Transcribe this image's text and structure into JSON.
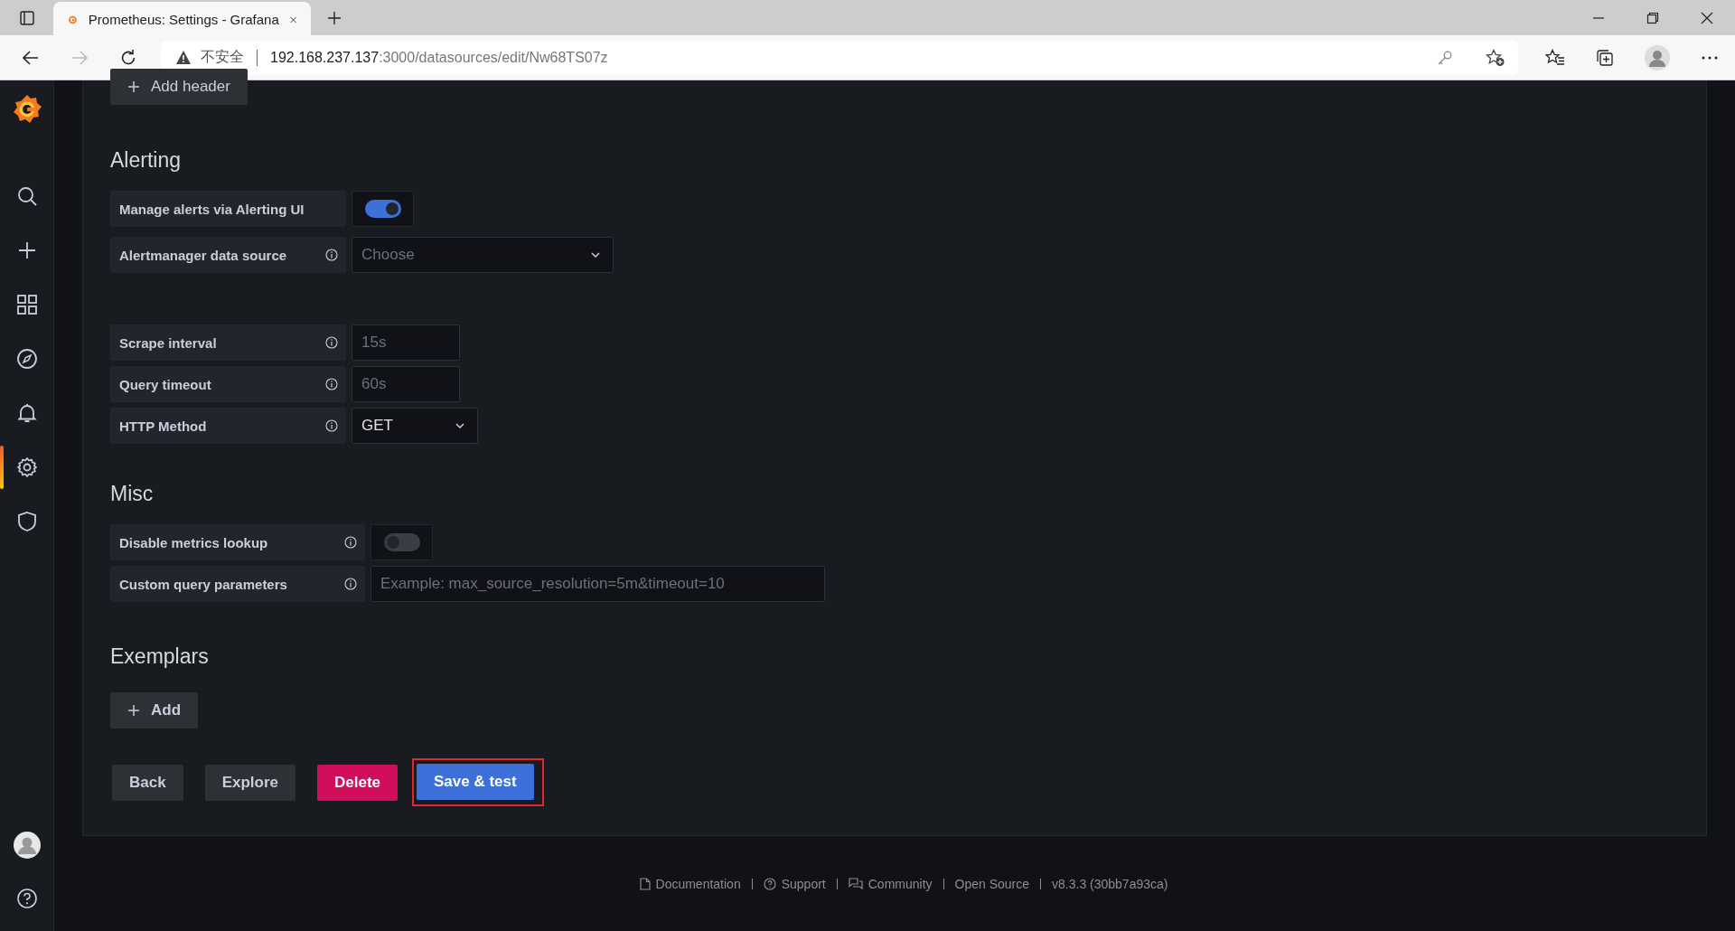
{
  "browser": {
    "tab_title": "Prometheus: Settings - Grafana",
    "security_label": "不安全",
    "address_host": "192.168.237.137",
    "address_rest": ":3000/datasources/edit/Nw68TS07z"
  },
  "sidebar": {
    "items": [
      {
        "kind": "search",
        "selected": false
      },
      {
        "kind": "create",
        "selected": false
      },
      {
        "kind": "dashboards",
        "selected": false
      },
      {
        "kind": "explore",
        "selected": false
      },
      {
        "kind": "alerting",
        "selected": false
      },
      {
        "kind": "configuration",
        "selected": true
      },
      {
        "kind": "admin",
        "selected": false
      }
    ]
  },
  "add_header_button": "Add header",
  "sections": [
    {
      "title": "Alerting",
      "groups": [
        [
          {
            "kind": "toggle",
            "label": "Manage alerts via Alerting UI",
            "info": false,
            "on": true
          },
          {
            "kind": "select",
            "label": "Alertmanager data source",
            "info": true,
            "placeholder": "Choose"
          }
        ],
        [
          {
            "kind": "input",
            "label": "Scrape interval",
            "info": true,
            "placeholder": "15s"
          },
          {
            "kind": "input",
            "label": "Query timeout",
            "info": true,
            "placeholder": "60s"
          },
          {
            "kind": "select",
            "label": "HTTP Method",
            "info": true,
            "value": "GET"
          }
        ]
      ]
    },
    {
      "title": "Misc",
      "groups": [
        [
          {
            "kind": "toggle",
            "label": "Disable metrics lookup",
            "info": true,
            "on": false
          },
          {
            "kind": "input",
            "label": "Custom query parameters",
            "info": true,
            "placeholder": "Example: max_source_resolution=5m&timeout=10"
          }
        ]
      ]
    },
    {
      "title": "Exemplars",
      "add_button": "Add"
    }
  ],
  "buttons": [
    {
      "kind": "secondary",
      "label": "Back",
      "highlighted": false
    },
    {
      "kind": "secondary",
      "label": "Explore",
      "highlighted": false
    },
    {
      "kind": "destructive",
      "label": "Delete",
      "highlighted": false
    },
    {
      "kind": "primary",
      "label": "Save & test",
      "highlighted": true
    }
  ],
  "footer": [
    {
      "kind": "document",
      "text": "Documentation"
    },
    {
      "kind": "question",
      "text": "Support"
    },
    {
      "kind": "chat",
      "text": "Community"
    },
    {
      "kind": "plain",
      "text": "Open Source"
    },
    {
      "kind": "plain",
      "text": "v8.3.3 (30bb7a93ca)"
    }
  ]
}
